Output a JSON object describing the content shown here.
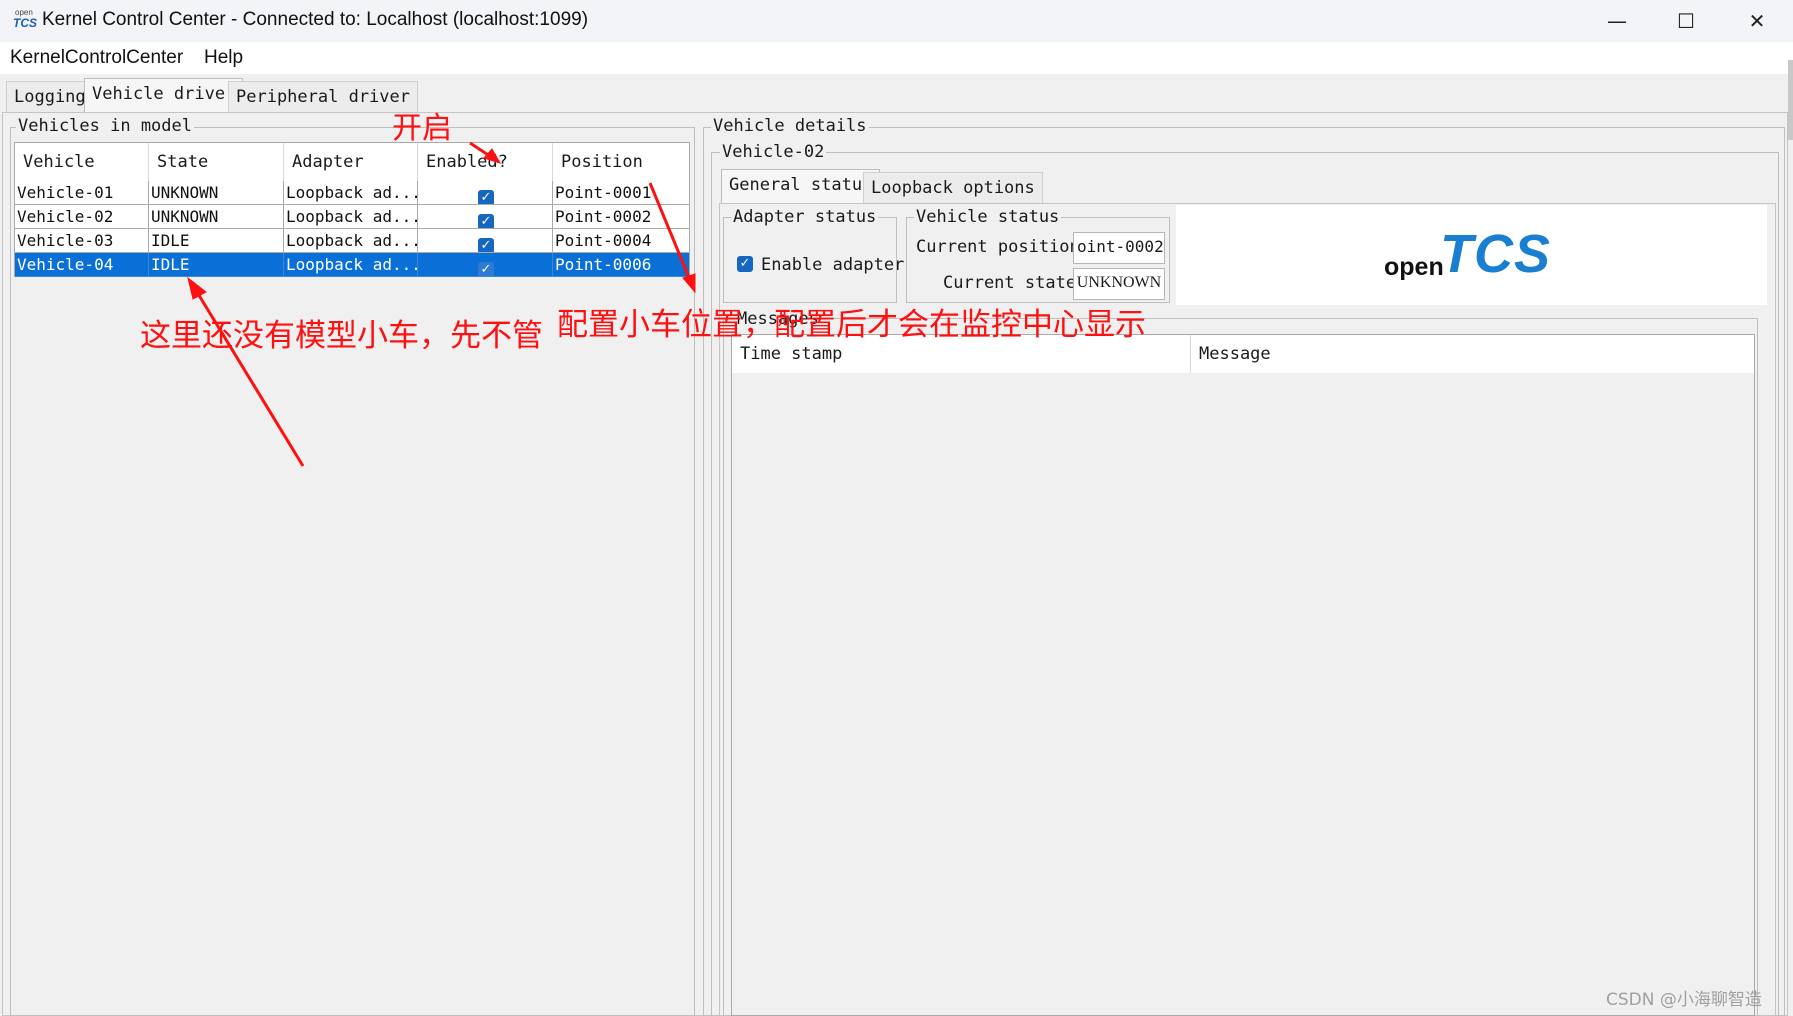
{
  "window": {
    "title": "Kernel Control Center - Connected to: Localhost (localhost:1099)",
    "icon_text_top": "open",
    "icon_text_bottom": "TCS",
    "minimize": "—",
    "maximize": "☐",
    "close": "✕"
  },
  "menu": [
    "KernelControlCenter",
    "Help"
  ],
  "tabs": [
    "Logging",
    "Vehicle driver",
    "Peripheral driver"
  ],
  "left": {
    "group_title": "Vehicles in model",
    "columns": [
      "Vehicle",
      "State",
      "Adapter",
      "Enabled?",
      "Position"
    ],
    "rows": [
      {
        "vehicle": "Vehicle-01",
        "state": "UNKNOWN",
        "adapter": "Loopback ad...",
        "enabled": true,
        "position": "Point-0001"
      },
      {
        "vehicle": "Vehicle-02",
        "state": "UNKNOWN",
        "adapter": "Loopback ad...",
        "enabled": true,
        "position": "Point-0002"
      },
      {
        "vehicle": "Vehicle-03",
        "state": "IDLE",
        "adapter": "Loopback ad...",
        "enabled": true,
        "position": "Point-0004"
      },
      {
        "vehicle": "Vehicle-04",
        "state": "IDLE",
        "adapter": "Loopback ad...",
        "enabled": true,
        "position": "Point-0006"
      }
    ],
    "selected_row": 3
  },
  "right": {
    "group_title": "Vehicle details",
    "vehicle_title": "Vehicle-02",
    "subtabs": [
      "General status",
      "Loopback options"
    ],
    "adapter_status": {
      "title": "Adapter status",
      "enable_label": "Enable adapter",
      "enabled": true
    },
    "vehicle_status": {
      "title": "Vehicle status",
      "position_label": "Current position:",
      "position_value": "oint-0002",
      "state_label": "Current state:",
      "state_value": "UNKNOWN"
    },
    "logo_open": "open",
    "logo_tcs": "TCS",
    "messages": {
      "title": "Messages",
      "columns": [
        "Time stamp",
        "Message"
      ]
    }
  },
  "annotations": {
    "enable": "开启",
    "no_model": "这里还没有模型小车，先不管",
    "config_pos": "配置小车位置，配置后才会在监控中心显示"
  },
  "watermark": "CSDN @小海聊智造",
  "colors": {
    "selection": "#0a6fd7",
    "annotation": "#ff1010",
    "logo_blue": "#1a7fd1"
  }
}
